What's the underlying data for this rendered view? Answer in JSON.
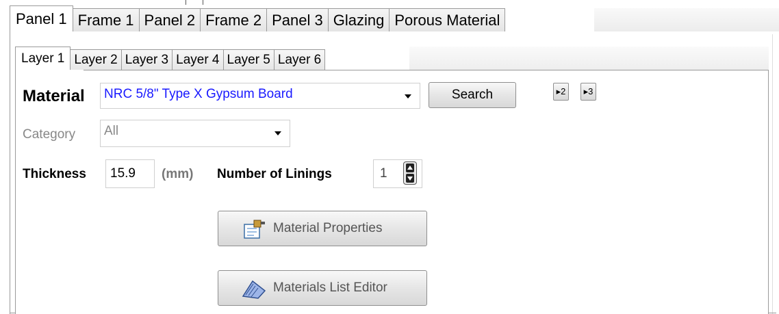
{
  "outer_tabs": [
    "Panel 1",
    "Frame 1",
    "Panel 2",
    "Frame 2",
    "Panel 3",
    "Glazing",
    "Porous Material"
  ],
  "inner_tabs": [
    "Layer 1",
    "Layer 2",
    "Layer 3",
    "Layer 4",
    "Layer 5",
    "Layer 6"
  ],
  "material": {
    "label": "Material",
    "value": "NRC 5/8\" Type X Gypsum Board",
    "value_color": "#1a1aff",
    "search_label": "Search",
    "mini_buttons": [
      "▸2",
      "▸3"
    ]
  },
  "category": {
    "label": "Category",
    "value": "All"
  },
  "thickness": {
    "label": "Thickness",
    "value": "15.9",
    "unit": "(mm)"
  },
  "linings": {
    "label": "Number of Linings",
    "value": "1"
  },
  "buttons": {
    "properties_label": "Material Properties",
    "properties_icon": "material-properties-icon",
    "editor_label": "Materials List Editor",
    "editor_icon": "notepad-icon"
  }
}
